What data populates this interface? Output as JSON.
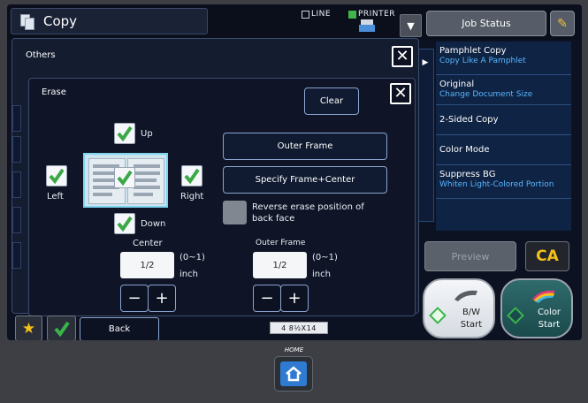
{
  "header": {
    "app_title": "Copy",
    "line_label": "LINE",
    "printer_label": "PRINTER",
    "job_status_label": "Job Status"
  },
  "right_panel": {
    "items": [
      {
        "title": "Pamphlet Copy",
        "subtitle": "Copy Like A Pamphlet"
      },
      {
        "title": "Original",
        "subtitle": "Change Document Size"
      },
      {
        "title": "2-Sided Copy",
        "subtitle": ""
      },
      {
        "title": "Color Mode",
        "subtitle": ""
      },
      {
        "title": "Suppress BG",
        "subtitle": "Whiten Light-Colored Portion"
      }
    ]
  },
  "buttons": {
    "preview": "Preview",
    "ca": "CA",
    "bw_start": "B/W\nStart",
    "color_start": "Color\nStart",
    "back": "Back"
  },
  "others_dialog": {
    "title": "Others"
  },
  "erase_dialog": {
    "title": "Erase",
    "clear": "Clear",
    "up": "Up",
    "down": "Down",
    "left": "Left",
    "right": "Right",
    "outer_frame_btn": "Outer Frame",
    "specify_frame_btn": "Specify Frame+Center",
    "reverse_label": "Reverse erase position of back face",
    "center_label": "Center",
    "center_value": "1/2",
    "center_range": "(0~1)",
    "center_unit": "inch",
    "outer_label": "Outer Frame",
    "outer_value": "1/2",
    "outer_range": "(0~1)",
    "outer_unit": "inch",
    "checked": {
      "up": true,
      "down": true,
      "left": true,
      "right": true,
      "center": true
    }
  },
  "paper_strip": "4 8½X14",
  "home_label": "HOME"
}
